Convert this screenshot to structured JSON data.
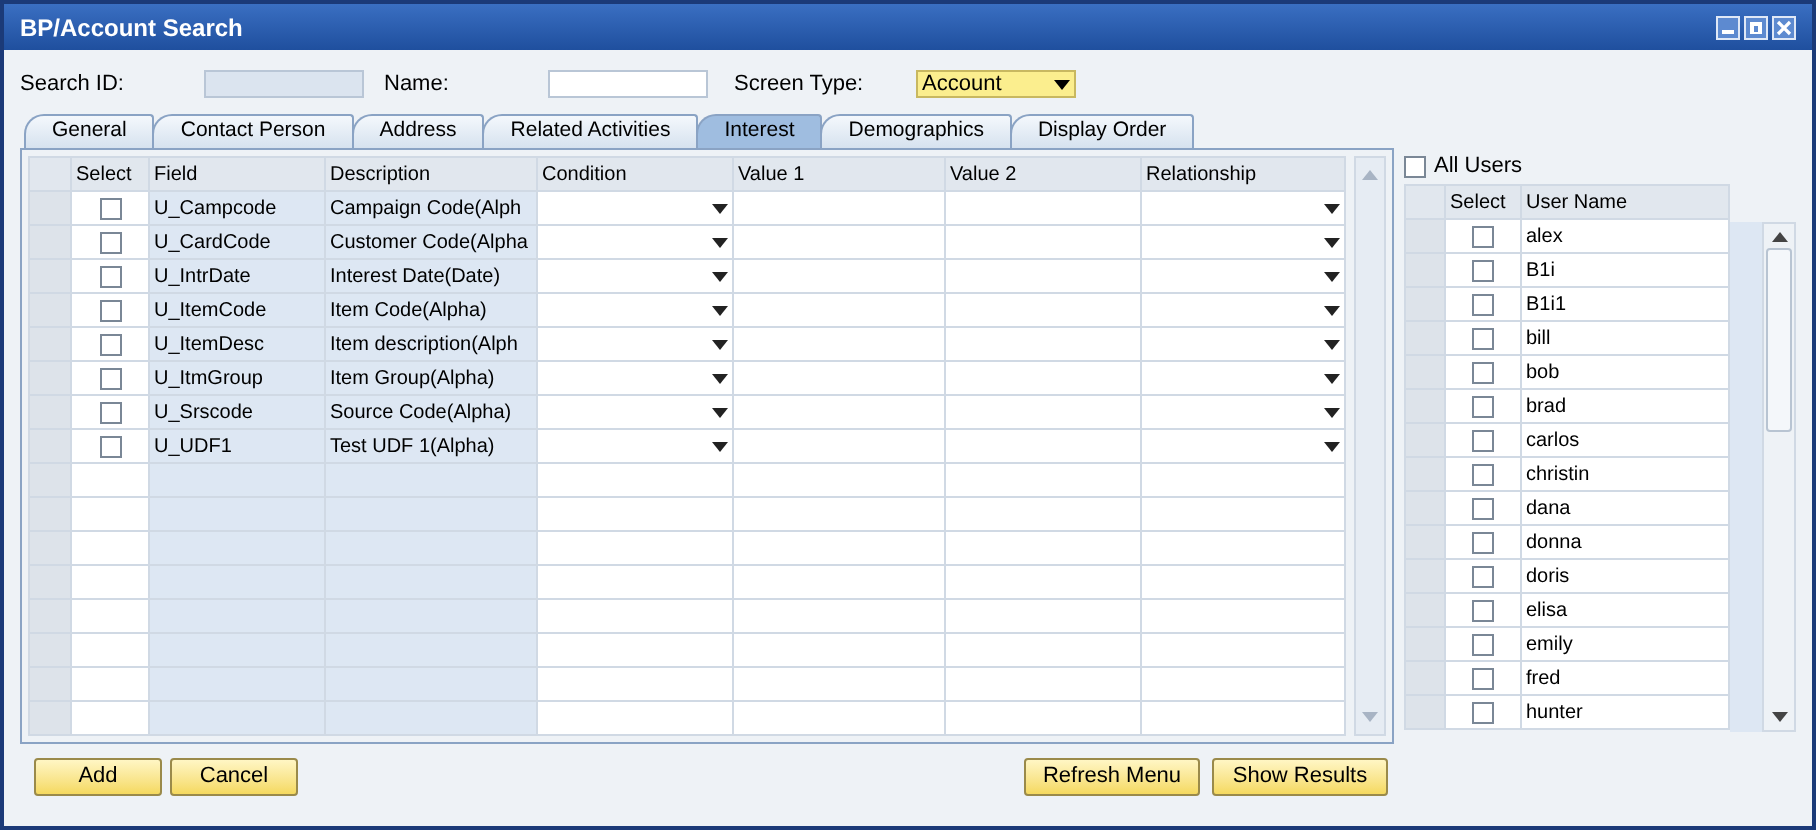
{
  "window": {
    "title": "BP/Account Search"
  },
  "header": {
    "search_id_label": "Search ID:",
    "name_label": "Name:",
    "screen_type_label": "Screen Type:",
    "screen_type_value": "Account"
  },
  "tabs": [
    {
      "label": "General",
      "selected": false
    },
    {
      "label": "Contact Person",
      "selected": false
    },
    {
      "label": "Address",
      "selected": false
    },
    {
      "label": "Related Activities",
      "selected": false
    },
    {
      "label": "Interest",
      "selected": true
    },
    {
      "label": "Demographics",
      "selected": false
    },
    {
      "label": "Display Order",
      "selected": false
    }
  ],
  "criteria_table": {
    "columns": [
      "Select",
      "Field",
      "Description",
      "Condition",
      "Value 1",
      "Value 2",
      "Relationship"
    ],
    "rows": [
      {
        "checked": false,
        "field": "U_Campcode",
        "description": "Campaign Code(Alph"
      },
      {
        "checked": false,
        "field": "U_CardCode",
        "description": "Customer Code(Alpha"
      },
      {
        "checked": false,
        "field": "U_IntrDate",
        "description": "Interest Date(Date)"
      },
      {
        "checked": false,
        "field": "U_ItemCode",
        "description": "Item Code(Alpha)"
      },
      {
        "checked": false,
        "field": "U_ItemDesc",
        "description": "Item description(Alph"
      },
      {
        "checked": false,
        "field": "U_ItmGroup",
        "description": "Item Group(Alpha)"
      },
      {
        "checked": false,
        "field": "U_Srscode",
        "description": "Source Code(Alpha)"
      },
      {
        "checked": false,
        "field": "U_UDF1",
        "description": "Test UDF 1(Alpha)"
      }
    ]
  },
  "all_users": {
    "label": "All Users",
    "checked": false
  },
  "users_table": {
    "columns": [
      "Select",
      "User Name"
    ],
    "rows": [
      {
        "checked": false,
        "name": "alex"
      },
      {
        "checked": false,
        "name": "B1i"
      },
      {
        "checked": false,
        "name": "B1i1"
      },
      {
        "checked": false,
        "name": "bill"
      },
      {
        "checked": false,
        "name": "bob"
      },
      {
        "checked": false,
        "name": "brad"
      },
      {
        "checked": false,
        "name": "carlos"
      },
      {
        "checked": false,
        "name": "christin"
      },
      {
        "checked": false,
        "name": "dana"
      },
      {
        "checked": false,
        "name": "donna"
      },
      {
        "checked": false,
        "name": "doris"
      },
      {
        "checked": false,
        "name": "elisa"
      },
      {
        "checked": false,
        "name": "emily"
      },
      {
        "checked": false,
        "name": "fred"
      },
      {
        "checked": false,
        "name": "hunter"
      }
    ]
  },
  "buttons_left": [
    "Add",
    "Cancel"
  ],
  "buttons_right": [
    "Refresh Menu",
    "Show Results"
  ]
}
